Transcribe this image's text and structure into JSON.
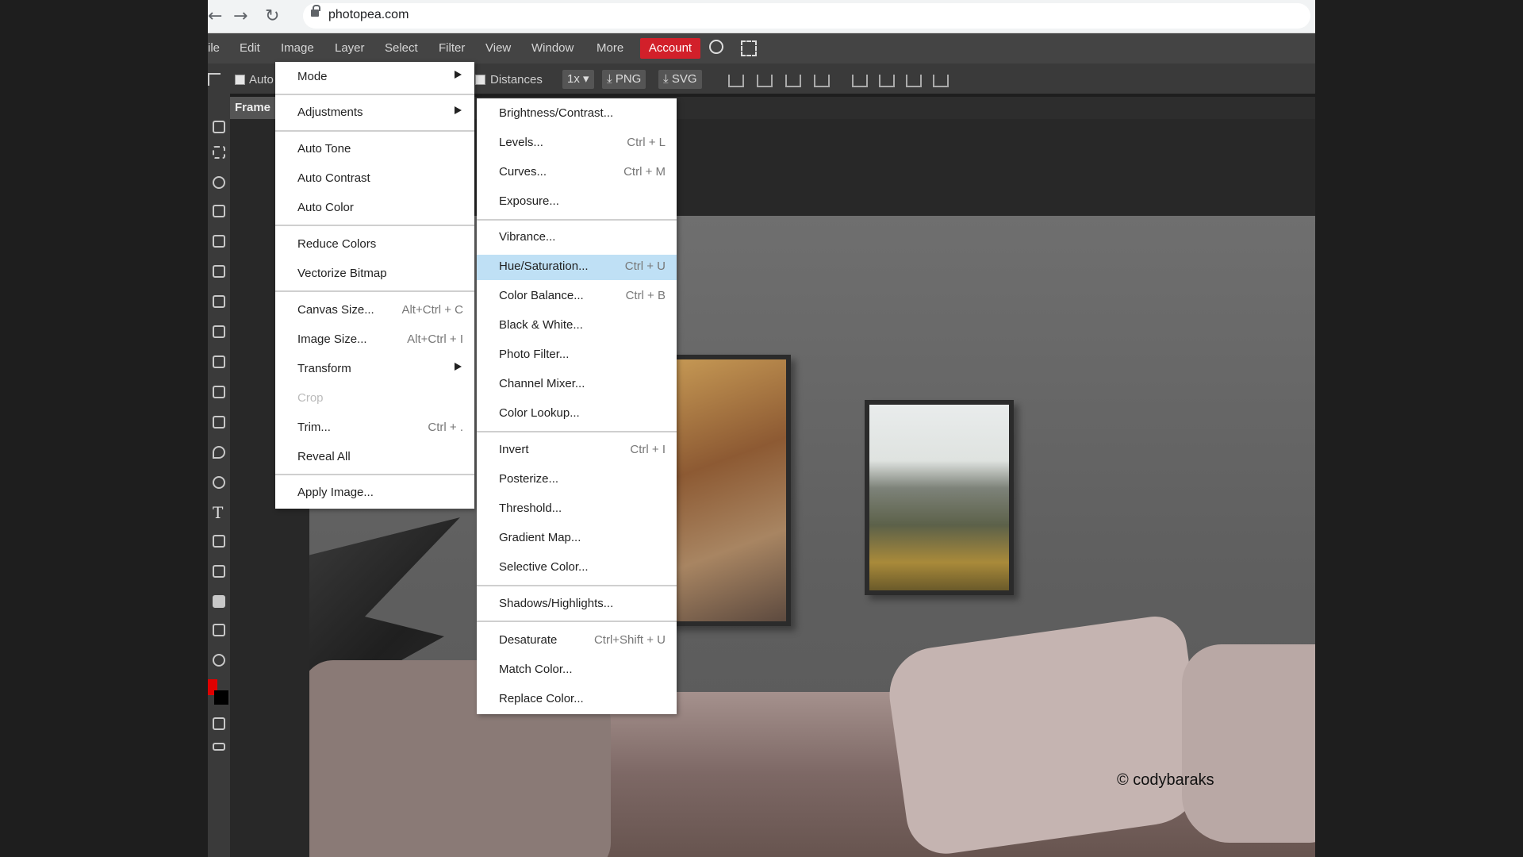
{
  "browser": {
    "url": "photopea.com",
    "back_icon": "back-arrow-icon",
    "forward_icon": "forward-arrow-icon",
    "reload_icon": "reload-icon"
  },
  "menubar": {
    "items": [
      "ile",
      "Edit",
      "Image",
      "Layer",
      "Select",
      "Filter",
      "View",
      "Window",
      "More"
    ],
    "account": "Account",
    "account_color": "#d2202a"
  },
  "options": {
    "auto_label": "Auto",
    "distances_label": "Distances",
    "zoom": "1x",
    "png": "PNG",
    "svg": "SVG"
  },
  "tab": {
    "label": "Frame"
  },
  "image_menu": {
    "items": [
      {
        "label": "Mode",
        "shortcut": "",
        "submenu": true
      },
      {
        "label": "Adjustments",
        "shortcut": "",
        "submenu": true
      },
      {
        "label": "Auto Tone",
        "shortcut": ""
      },
      {
        "label": "Auto Contrast",
        "shortcut": ""
      },
      {
        "label": "Auto Color",
        "shortcut": ""
      },
      {
        "label": "Reduce Colors",
        "shortcut": ""
      },
      {
        "label": "Vectorize Bitmap",
        "shortcut": ""
      },
      {
        "label": "Canvas Size...",
        "shortcut": "Alt+Ctrl + C"
      },
      {
        "label": "Image Size...",
        "shortcut": "Alt+Ctrl + I"
      },
      {
        "label": "Transform",
        "shortcut": "",
        "submenu": true
      },
      {
        "label": "Crop",
        "shortcut": "",
        "disabled": true
      },
      {
        "label": "Trim...",
        "shortcut": "Ctrl + ."
      },
      {
        "label": "Reveal All",
        "shortcut": ""
      },
      {
        "label": "Apply Image...",
        "shortcut": ""
      }
    ]
  },
  "adjustments_menu": {
    "highlighted": "Hue/Saturation...",
    "items": [
      {
        "label": "Brightness/Contrast...",
        "shortcut": ""
      },
      {
        "label": "Levels...",
        "shortcut": "Ctrl + L"
      },
      {
        "label": "Curves...",
        "shortcut": "Ctrl + M"
      },
      {
        "label": "Exposure...",
        "shortcut": ""
      },
      {
        "label": "Vibrance...",
        "shortcut": ""
      },
      {
        "label": "Hue/Saturation...",
        "shortcut": "Ctrl + U"
      },
      {
        "label": "Color Balance...",
        "shortcut": "Ctrl + B"
      },
      {
        "label": "Black & White...",
        "shortcut": ""
      },
      {
        "label": "Photo Filter...",
        "shortcut": ""
      },
      {
        "label": "Channel Mixer...",
        "shortcut": ""
      },
      {
        "label": "Color Lookup...",
        "shortcut": ""
      },
      {
        "label": "Invert",
        "shortcut": "Ctrl + I"
      },
      {
        "label": "Posterize...",
        "shortcut": ""
      },
      {
        "label": "Threshold...",
        "shortcut": ""
      },
      {
        "label": "Gradient Map...",
        "shortcut": ""
      },
      {
        "label": "Selective Color...",
        "shortcut": ""
      },
      {
        "label": "Shadows/Highlights...",
        "shortcut": ""
      },
      {
        "label": "Desaturate",
        "shortcut": "Ctrl+Shift + U"
      },
      {
        "label": "Match Color...",
        "shortcut": ""
      },
      {
        "label": "Replace Color...",
        "shortcut": ""
      }
    ]
  },
  "canvas": {
    "credit": "© codybaraks"
  },
  "colors": {
    "foreground": "#e00000",
    "background": "#000000",
    "highlight": "#bfe0f5"
  }
}
